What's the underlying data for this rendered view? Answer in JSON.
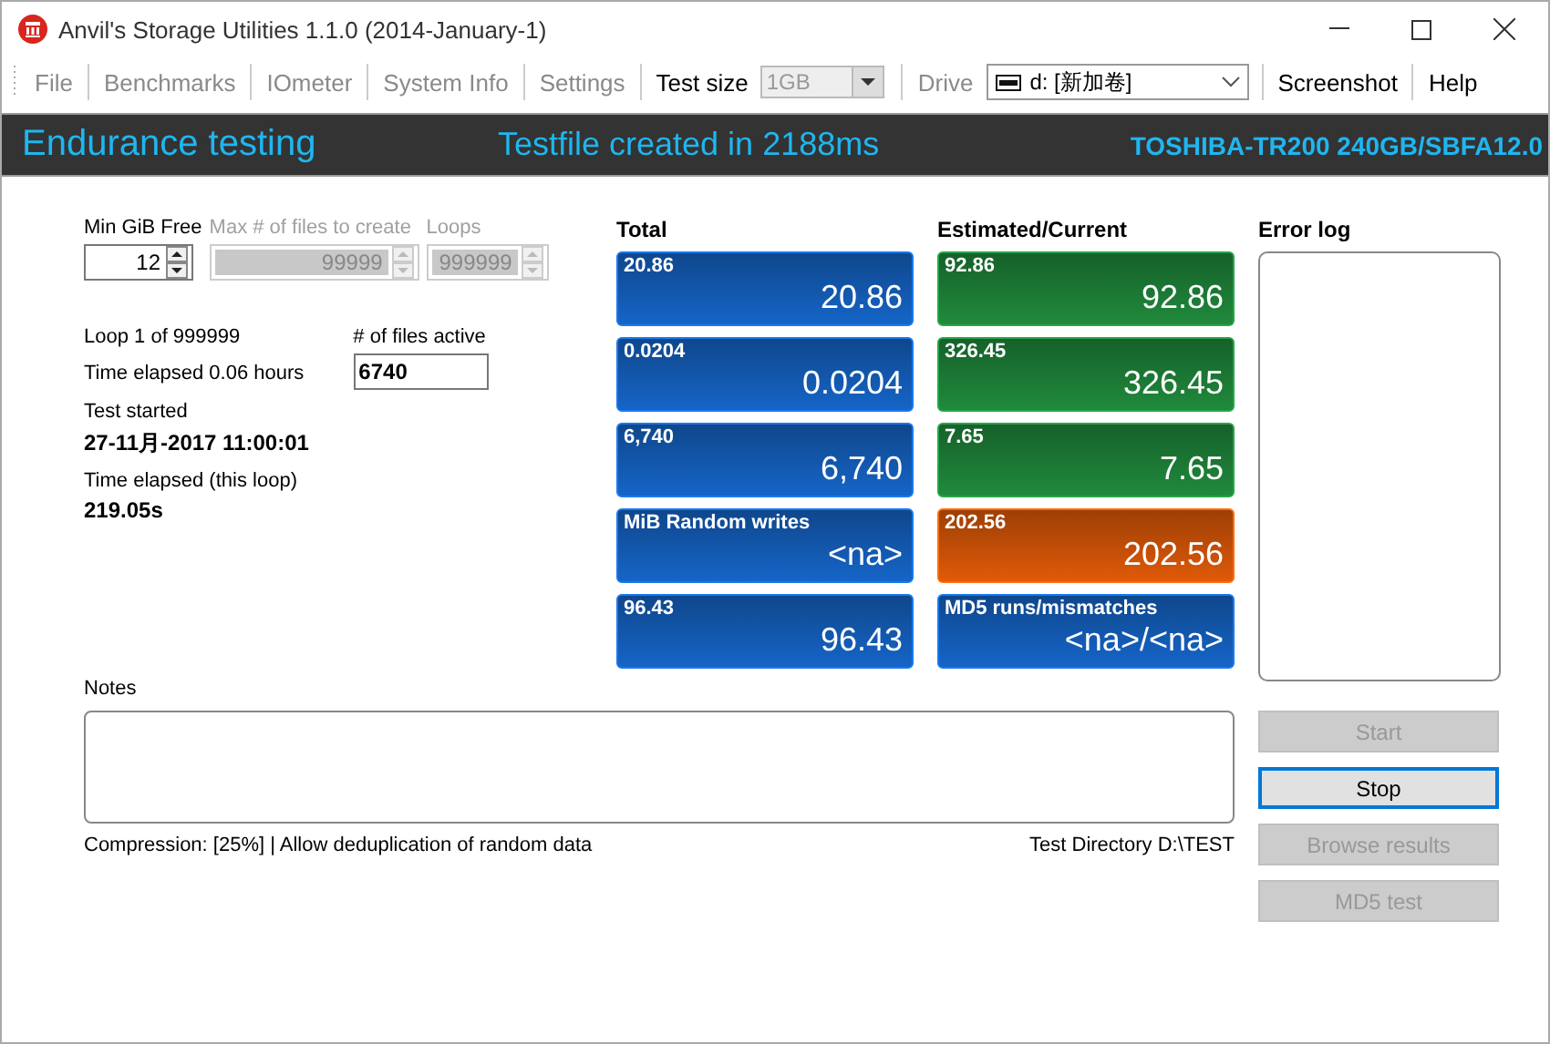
{
  "window": {
    "title": "Anvil's Storage Utilities 1.1.0 (2014-January-1)"
  },
  "toolbar": [
    {
      "kind": "menu",
      "label": "File",
      "disabled": true
    },
    {
      "kind": "menu",
      "label": "Benchmarks",
      "disabled": true
    },
    {
      "kind": "menu",
      "label": "IOmeter",
      "disabled": true
    },
    {
      "kind": "menu",
      "label": "System Info",
      "disabled": true
    },
    {
      "kind": "menu",
      "label": "Settings",
      "disabled": true
    },
    {
      "kind": "label",
      "label": "Test size",
      "disabled": false
    },
    {
      "kind": "combo",
      "label": "1GB",
      "disabled": true
    },
    {
      "kind": "label",
      "label": "Drive",
      "disabled": true
    },
    {
      "kind": "drive",
      "label": "d: [新加卷]",
      "disabled": false
    },
    {
      "kind": "menu",
      "label": "Screenshot",
      "disabled": false
    },
    {
      "kind": "menu",
      "label": "Help",
      "disabled": false
    }
  ],
  "header": {
    "mode": "Endurance testing",
    "status": "Testfile created in 2188ms",
    "device": "TOSHIBA-TR200 240GB/SBFA12.0"
  },
  "spinners": [
    {
      "label": "Min GiB Free",
      "value": "12",
      "disabled": false
    },
    {
      "label": "Max # of files to create",
      "value": "99999",
      "disabled": true
    },
    {
      "label": "Loops",
      "value": "999999",
      "disabled": true
    }
  ],
  "loop": "Loop 1 of 999999",
  "time_elapsed": "Time elapsed 0.06 hours",
  "files_active": {
    "label": "# of files active",
    "value": "6740"
  },
  "test_started": {
    "label": "Test started",
    "value": "27-11月-2017 11:00:01"
  },
  "time_loop": {
    "label": "Time elapsed (this loop)",
    "value": "219.05s"
  },
  "total": {
    "title": "Total",
    "tiles": [
      {
        "caption": "20.86",
        "value": "20.86",
        "color": "#1565c8"
      },
      {
        "caption": "0.0204",
        "value": "0.0204",
        "color": "#1565c8"
      },
      {
        "caption": "6,740",
        "value": "6,740",
        "color": "#1565c8"
      },
      {
        "caption": "MiB Random writes",
        "value": "<na>",
        "color": "#1565c8"
      },
      {
        "caption": "96.43",
        "value": "96.43",
        "color": "#1565c8"
      }
    ]
  },
  "estimated": {
    "title": "Estimated/Current",
    "tiles": [
      {
        "caption": "92.86",
        "value": "92.86",
        "color": "#208a3c"
      },
      {
        "caption": "326.45",
        "value": "326.45",
        "color": "#208a3c"
      },
      {
        "caption": "7.65",
        "value": "7.65",
        "color": "#208a3c"
      },
      {
        "caption": "202.56",
        "value": "202.56",
        "color": "#e05a08"
      },
      {
        "caption": "MD5 runs/mismatches",
        "value": "<na>/<na>",
        "color": "#1565c8"
      }
    ]
  },
  "error_log": {
    "title": "Error log"
  },
  "notes": {
    "label": "Notes"
  },
  "status": {
    "left": "Compression: [25%] | Allow deduplication of random data",
    "right": "Test Directory D:\\TEST"
  },
  "buttons": [
    {
      "label": "Start",
      "disabled": true,
      "focused": false
    },
    {
      "label": "Stop",
      "disabled": false,
      "focused": true
    },
    {
      "label": "Browse results",
      "disabled": true,
      "focused": false
    },
    {
      "label": "MD5 test",
      "disabled": true,
      "focused": false
    }
  ]
}
